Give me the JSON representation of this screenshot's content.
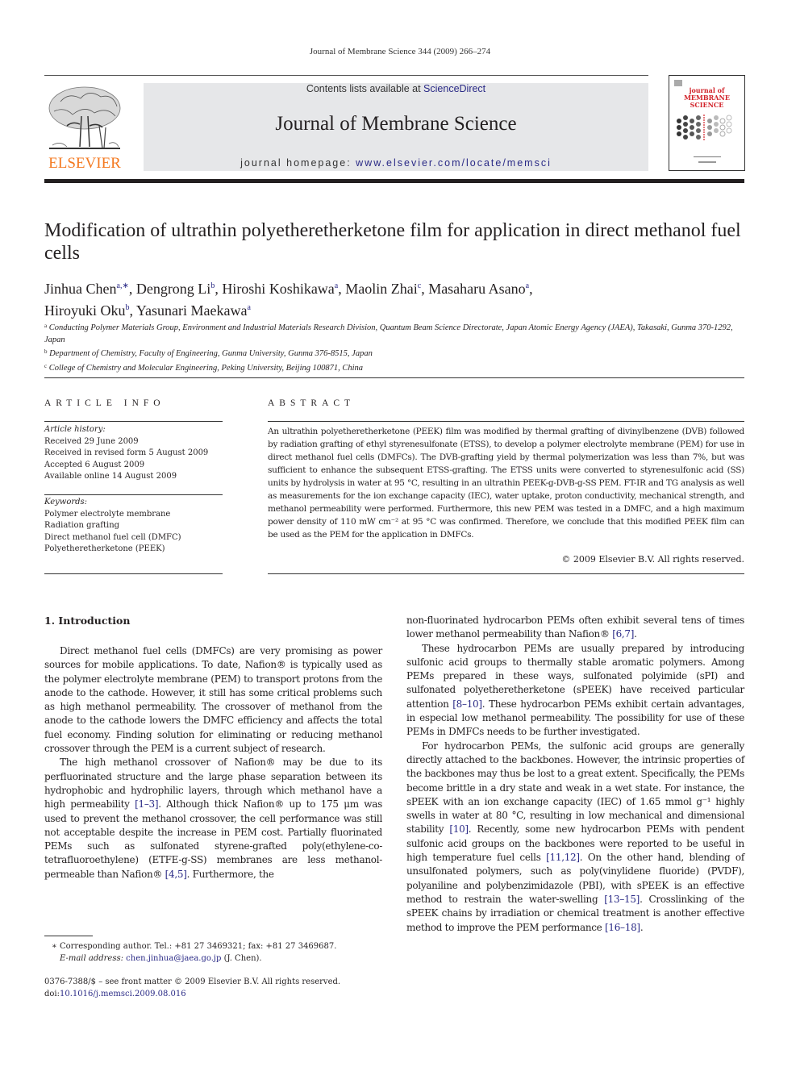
{
  "header": {
    "citation": "Journal of Membrane Science 344 (2009) 266–274",
    "contents_prefix": "Contents lists available at ",
    "contents_link": "ScienceDirect",
    "journal_title": "Journal of Membrane Science",
    "homepage_prefix": "journal homepage: ",
    "homepage_link": "www.elsevier.com/locate/memsci",
    "publisher_logo_text": "ELSEVIER",
    "cover_title_line1": "journal of",
    "cover_title_line2": "MEMBRANE",
    "cover_title_line3": "SCIENCE",
    "colors": {
      "publisher_orange": "#f47920",
      "link_blue": "#2a2a86",
      "cover_red": "#d2232a",
      "banner_gray": "#e6e7e9"
    }
  },
  "article": {
    "title": "Modification of ultrathin polyetheretherketone film for application in direct methanol fuel cells",
    "authors": [
      {
        "name": "Jinhua Chen",
        "sup": "a,∗",
        "sep": ", "
      },
      {
        "name": "Dengrong Li",
        "sup": "b",
        "sep": ", "
      },
      {
        "name": "Hiroshi Koshikawa",
        "sup": "a",
        "sep": ", "
      },
      {
        "name": "Maolin Zhai",
        "sup": "c",
        "sep": ", "
      },
      {
        "name": "Masaharu Asano",
        "sup": "a",
        "sep": ","
      },
      {
        "name": "Hiroyuki Oku",
        "sup": "b",
        "sep": ", "
      },
      {
        "name": "Yasunari Maekawa",
        "sup": "a",
        "sep": ""
      }
    ],
    "affiliations": [
      {
        "mark": "a",
        "text": "Conducting Polymer Materials Group, Environment and Industrial Materials Research Division, Quantum Beam Science Directorate, Japan Atomic Energy Agency (JAEA), Takasaki, Gunma 370-1292, Japan"
      },
      {
        "mark": "b",
        "text": "Department of Chemistry, Faculty of Engineering, Gunma University, Gunma 376-8515, Japan"
      },
      {
        "mark": "c",
        "text": "College of Chemistry and Molecular Engineering, Peking University, Beijing 100871, China"
      }
    ]
  },
  "article_info": {
    "heading": "ARTICLE INFO",
    "history_label": "Article history:",
    "history": [
      "Received 29 June 2009",
      "Received in revised form 5 August 2009",
      "Accepted 6 August 2009",
      "Available online 14 August 2009"
    ],
    "keywords_label": "Keywords:",
    "keywords": [
      "Polymer electrolyte membrane",
      "Radiation grafting",
      "Direct methanol fuel cell (DMFC)",
      "Polyetheretherketone (PEEK)"
    ]
  },
  "abstract": {
    "heading": "ABSTRACT",
    "text": "An ultrathin polyetheretherketone (PEEK) film was modified by thermal grafting of divinylbenzene (DVB) followed by radiation grafting of ethyl styrenesulfonate (ETSS), to develop a polymer electrolyte membrane (PEM) for use in direct methanol fuel cells (DMFCs). The DVB-grafting yield by thermal polymerization was less than 7%, but was sufficient to enhance the subsequent ETSS-grafting. The ETSS units were converted to styrenesulfonic acid (SS) units by hydrolysis in water at 95 °C, resulting in an ultrathin PEEK-g-DVB-g-SS PEM. FT-IR and TG analysis as well as measurements for the ion exchange capacity (IEC), water uptake, proton conductivity, mechanical strength, and methanol permeability were performed. Furthermore, this new PEM was tested in a DMFC, and a high maximum power density of 110 mW cm⁻² at 95 °C was confirmed. Therefore, we conclude that this modified PEEK film can be used as the PEM for the application in DMFCs.",
    "copyright": "© 2009 Elsevier B.V. All rights reserved."
  },
  "intro": {
    "heading": "1.  Introduction",
    "left_p1": "Direct methanol fuel cells (DMFCs) are very promising as power sources for mobile applications. To date, Nafion® is typically used as the polymer electrolyte membrane (PEM) to transport protons from the anode to the cathode. However, it still has some critical problems such as high methanol permeability. The crossover of methanol from the anode to the cathode lowers the DMFC efficiency and affects the total fuel economy. Finding solution for eliminating or reducing methanol crossover through the PEM is a current subject of research.",
    "left_p2_a": "The high methanol crossover of Nafion® may be due to its perfluorinated structure and the large phase separation between its hydrophobic and hydrophilic layers, through which methanol have a high permeability ",
    "left_p2_ref1": "[1–3]",
    "left_p2_b": ". Although thick Nafion® up to 175 μm was used to prevent the methanol crossover, the cell performance was still not acceptable despite the increase in PEM cost. Partially fluorinated PEMs such as sulfonated styrene-grafted poly(ethylene-co-tetrafluoroethylene) (ETFE-g-SS) membranes are less methanol-permeable than Nafion® ",
    "left_p2_ref2": "[4,5]",
    "left_p2_c": ". Furthermore, the",
    "right_p0_a": "non-fluorinated hydrocarbon PEMs often exhibit several tens of times lower methanol permeability than Nafion® ",
    "right_p0_ref": "[6,7]",
    "right_p0_b": ".",
    "right_p1_a": "These hydrocarbon PEMs are usually prepared by introducing sulfonic acid groups to thermally stable aromatic polymers. Among PEMs prepared in these ways, sulfonated polyimide (sPI) and sulfonated polyetheretherketone (sPEEK) have received particular attention ",
    "right_p1_ref": "[8–10]",
    "right_p1_b": ". These hydrocarbon PEMs exhibit certain advantages, in especial low methanol permeability. The possibility for use of these PEMs in DMFCs needs to be further investigated.",
    "right_p2_a": "For hydrocarbon PEMs, the sulfonic acid groups are generally directly attached to the backbones. However, the intrinsic properties of the backbones may thus be lost to a great extent. Specifically, the PEMs become brittle in a dry state and weak in a wet state. For instance, the sPEEK with an ion exchange capacity (IEC) of 1.65 mmol g⁻¹ highly swells in water at 80 °C, resulting in low mechanical and dimensional stability ",
    "right_p2_ref1": "[10]",
    "right_p2_b": ". Recently, some new hydrocarbon PEMs with pendent sulfonic acid groups on the backbones were reported to be useful in high temperature fuel cells ",
    "right_p2_ref2": "[11,12]",
    "right_p2_c": ". On the other hand, blending of unsulfonated polymers, such as poly(vinylidene fluoride) (PVDF), polyaniline and polybenzimidazole (PBI), with sPEEK is an effective method to restrain the water-swelling ",
    "right_p2_ref3": "[13–15]",
    "right_p2_d": ". Crosslinking of the sPEEK chains by irradiation or chemical treatment is another effective method to improve the PEM performance ",
    "right_p2_ref4": "[16–18]",
    "right_p2_e": "."
  },
  "footnotes": {
    "corresponding": "∗  Corresponding author. Tel.: +81 27 3469321; fax: +81 27 3469687.",
    "email_label": "E-mail address: ",
    "email": "chen.jinhua@jaea.go.jp",
    "email_suffix": " (J. Chen).",
    "front_matter": "0376-7388/$ – see front matter © 2009 Elsevier B.V. All rights reserved.",
    "doi_label": "doi:",
    "doi": "10.1016/j.memsci.2009.08.016"
  }
}
